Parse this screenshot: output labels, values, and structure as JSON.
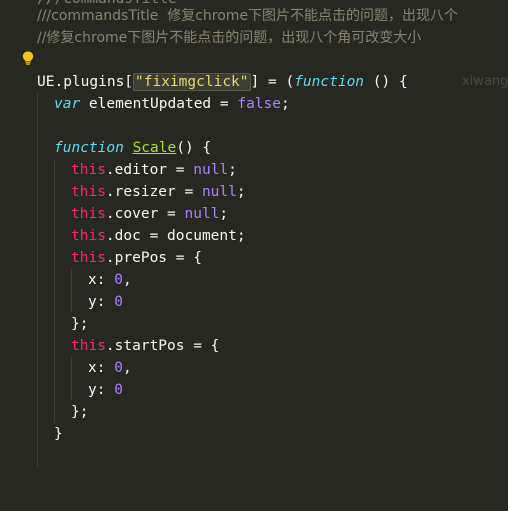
{
  "editor": {
    "top_partial": "///commandsTitle",
    "lines": {
      "l1_comment": "///commandsTitle  修复chrome下图片不能点击的问题，出现八个",
      "l2_comment": "//修复chrome下图片不能点击的问题，出现八个角可改变大小",
      "l4_ue": "UE.plugins[",
      "l4_str": "\"fiximgclick\"",
      "l4_rest": "] = (",
      "l4_fn": "function",
      "l4_end": " () {",
      "l4_ghost": "xiwang",
      "l5_var": "var",
      "l5_rest": " elementUpdated = ",
      "l5_false": "false",
      "l5_semi": ";",
      "l7_fn": "function",
      "l7_name": "Scale",
      "l7_rest": "() {",
      "l8_this": "this",
      "l8_rest": ".editor = ",
      "l8_val": "null",
      "l8_semi": ";",
      "l9_this": "this",
      "l9_rest": ".resizer = ",
      "l9_val": "null",
      "l9_semi": ";",
      "l10_this": "this",
      "l10_rest": ".cover = ",
      "l10_val": "null",
      "l10_semi": ";",
      "l11_this": "this",
      "l11_rest": ".doc = document;",
      "l12_this": "this",
      "l12_rest": ".prePos = {",
      "l13_key": "x: ",
      "l13_val": "0",
      "l13_comma": ",",
      "l14_key": "y: ",
      "l14_val": "0",
      "l15": "};",
      "l16_this": "this",
      "l16_rest": ".startPos = {",
      "l17_key": "x: ",
      "l17_val": "0",
      "l17_comma": ",",
      "l18_key": "y: ",
      "l18_val": "0",
      "l19": "};",
      "l20": "}"
    }
  },
  "icons": {
    "lightbulb": "lightbulb-icon"
  },
  "colors": {
    "background": "#272822",
    "foreground": "#f8f8f2",
    "comment": "#88846f",
    "keyword": "#f92672",
    "storage": "#66d9ef",
    "string": "#e6db74",
    "number": "#ae81ff",
    "function_name": "#a6e22e",
    "lightbulb": "#f0c419"
  }
}
